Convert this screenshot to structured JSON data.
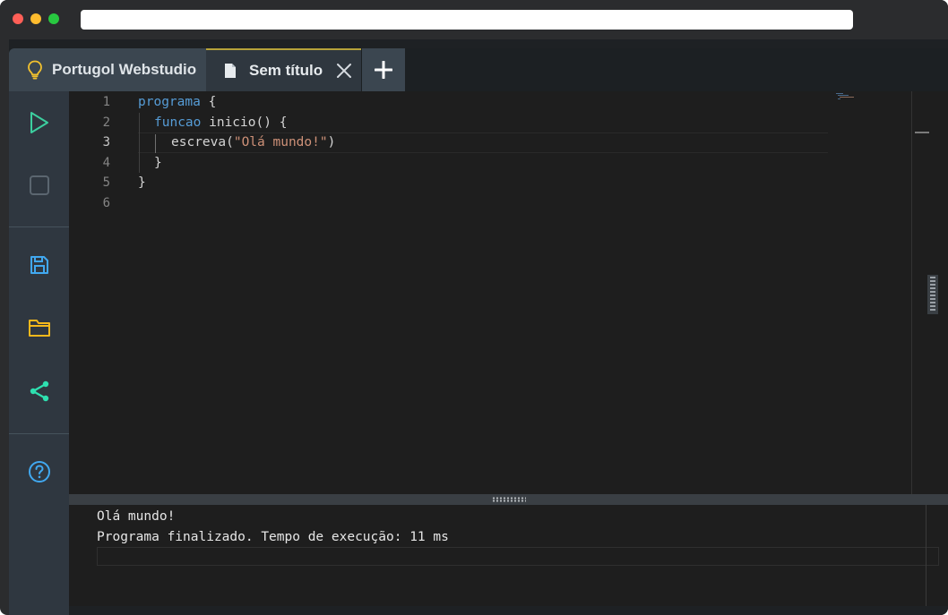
{
  "window": {
    "traffic_lights": [
      "#ff5f57",
      "#febc2e",
      "#28c840"
    ],
    "address": ""
  },
  "tabs": {
    "home": {
      "label": "Portugol Webstudio",
      "icon": "lightbulb-icon",
      "icon_color": "#f2c12e"
    },
    "file": {
      "label": "Sem título",
      "icon": "document-icon",
      "active_border": "#b6a23a"
    },
    "add": {
      "icon": "plus-icon"
    }
  },
  "sidebar": {
    "buttons": [
      {
        "name": "run",
        "icon": "play-icon",
        "color": "#3ccf9f"
      },
      {
        "name": "stop",
        "icon": "stop-icon",
        "color": "#5b6670"
      },
      {
        "name": "save",
        "icon": "save-icon",
        "color": "#41a8f0"
      },
      {
        "name": "open",
        "icon": "folder-icon",
        "color": "#f5b81c"
      },
      {
        "name": "share",
        "icon": "share-icon",
        "color": "#2ee0b0"
      },
      {
        "name": "help",
        "icon": "help-icon",
        "color": "#41a8f0"
      }
    ]
  },
  "editor": {
    "active_line": 3,
    "line_numbers": [
      "1",
      "2",
      "3",
      "4",
      "5",
      "6"
    ],
    "lines": [
      {
        "keyword": "programa",
        "rest": " {"
      },
      {
        "keyword": "funcao",
        "rest": " inicio() {"
      },
      {
        "text": "escreva(",
        "string": "\"Olá mundo!\"",
        "close": ")"
      },
      {
        "text": "}"
      },
      {
        "text": "}"
      },
      {
        "text": ""
      }
    ]
  },
  "console": {
    "output": [
      "Olá mundo!",
      "Programa finalizado. Tempo de execução: 11 ms"
    ],
    "input_value": ""
  }
}
